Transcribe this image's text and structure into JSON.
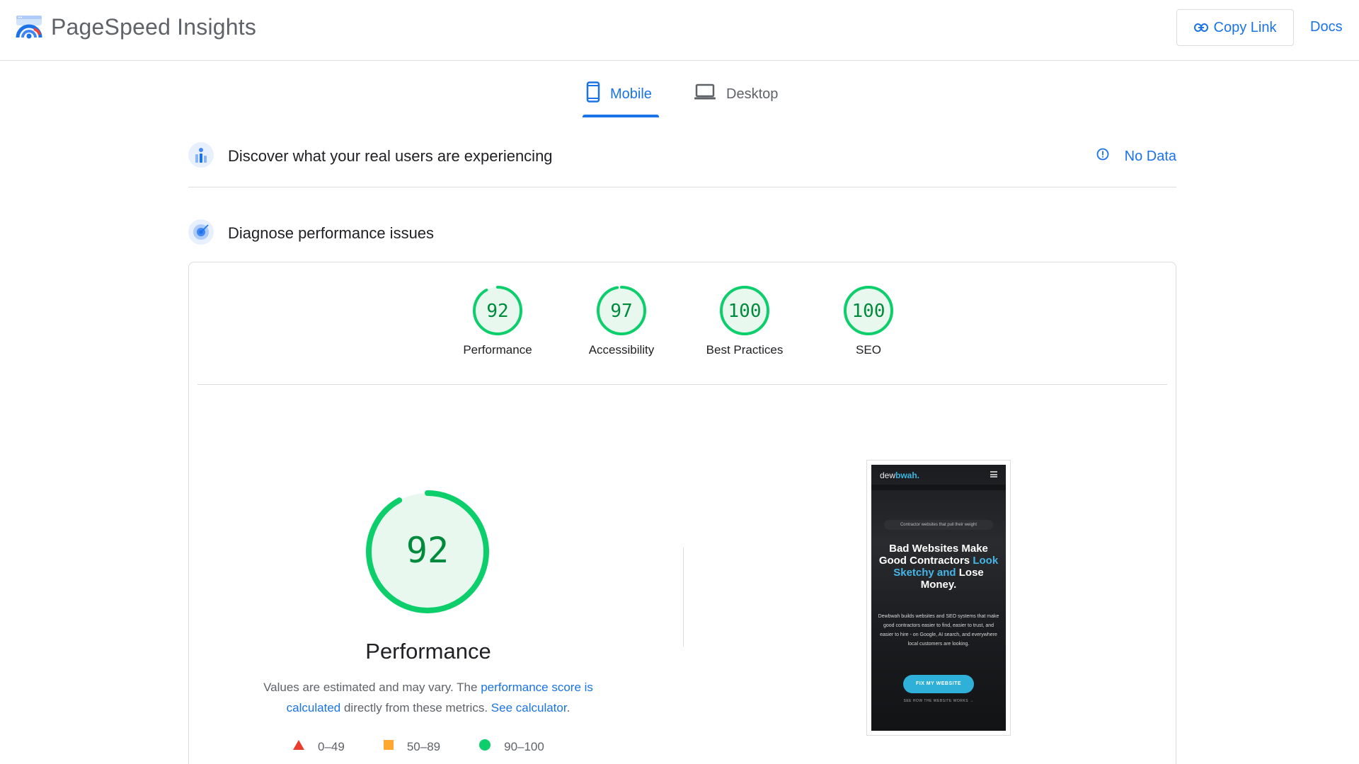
{
  "header": {
    "brand_name": "PageSpeed Insights",
    "copy_link_label": "Copy Link",
    "docs_label": "Docs"
  },
  "tabs": [
    {
      "label": "Mobile",
      "selected": true
    },
    {
      "label": "Desktop",
      "selected": false
    }
  ],
  "field_data": {
    "title": "Discover what your real users are experiencing",
    "status_label": "No Data"
  },
  "diagnose": {
    "title": "Diagnose performance issues"
  },
  "scores": [
    {
      "label": "Performance",
      "value": "92",
      "fraction": 0.92
    },
    {
      "label": "Accessibility",
      "value": "97",
      "fraction": 0.97
    },
    {
      "label": "Best Practices",
      "value": "100",
      "fraction": 1.0
    },
    {
      "label": "SEO",
      "value": "100",
      "fraction": 1.0
    }
  ],
  "performance": {
    "score": "92",
    "fraction": 0.92,
    "title": "Performance",
    "note_prefix": "Values are estimated and may vary. The ",
    "note_link1": "performance score is calculated",
    "note_middle": " directly from these metrics. ",
    "note_link2": "See calculator",
    "note_suffix": "."
  },
  "legend": [
    {
      "label": "0–49",
      "shape": "triangle",
      "color": "#eb3d2f"
    },
    {
      "label": "50–89",
      "shape": "square",
      "color": "#ffa733"
    },
    {
      "label": "90–100",
      "shape": "circle",
      "color": "#0cce6b"
    }
  ],
  "colors": {
    "accent": "#1a73e8",
    "pass": "#0cce6b",
    "pass_text": "#008a3c",
    "pass_fill": "#e8f8ee"
  },
  "screenshot": {
    "logo_prefix": "dew",
    "logo_accent": "bwah.",
    "badge": "Contractor websites that pull their weight",
    "headline_white": "Bad Websites Make Good Contractors",
    "headline_blue": "Look Sketchy and",
    "headline_end": "Lose Money.",
    "body": "Dewbwah builds websites and SEO systems that make good contractors easier to find, easier to trust, and easier to hire - on Google, AI search, and everywhere local customers are looking.",
    "cta": "FIX MY WEBSITE",
    "sub_link": "SEE HOW THE WEBSITE WORKS →"
  }
}
